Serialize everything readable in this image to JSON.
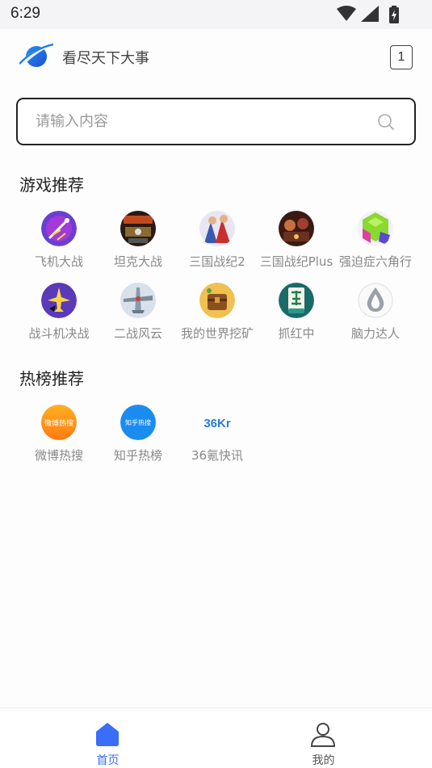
{
  "status_bar": {
    "time": "6:29"
  },
  "header": {
    "title": "看尽天下大事",
    "tab_count": "1"
  },
  "search": {
    "placeholder": "请输入内容",
    "value": ""
  },
  "games": {
    "title": "游戏推荐",
    "items": [
      {
        "label": "飞机大战",
        "icon": "plane-war-icon"
      },
      {
        "label": "坦克大战",
        "icon": "tank-war-icon"
      },
      {
        "label": "三国战纪2",
        "icon": "three-kingdoms-2-icon"
      },
      {
        "label": "三国战纪Plus",
        "icon": "three-kingdoms-plus-icon"
      },
      {
        "label": "强迫症六角行",
        "icon": "hexagon-puzzle-icon"
      },
      {
        "label": "战斗机决战",
        "icon": "fighter-jet-icon"
      },
      {
        "label": "二战风云",
        "icon": "ww2-plane-icon"
      },
      {
        "label": "我的世界挖矿",
        "icon": "treasure-chest-icon"
      },
      {
        "label": "抓红中",
        "icon": "mahjong-tile-icon"
      },
      {
        "label": "脑力达人",
        "icon": "water-drop-icon"
      }
    ]
  },
  "hot": {
    "title": "热榜推荐",
    "items": [
      {
        "label": "微博热搜",
        "icon": "weibo-hot-icon",
        "badge": "微博热搜"
      },
      {
        "label": "知乎热榜",
        "icon": "zhihu-hot-icon",
        "badge": "知乎热搜"
      },
      {
        "label": "36氪快讯",
        "icon": "36kr-icon",
        "badge": "36Kr"
      }
    ]
  },
  "bottom_nav": {
    "items": [
      {
        "label": "首页",
        "icon": "home-icon",
        "active": true
      },
      {
        "label": "我的",
        "icon": "user-icon",
        "active": false
      }
    ]
  },
  "colors": {
    "accent": "#3b6ef6",
    "inactive": "#555555"
  }
}
